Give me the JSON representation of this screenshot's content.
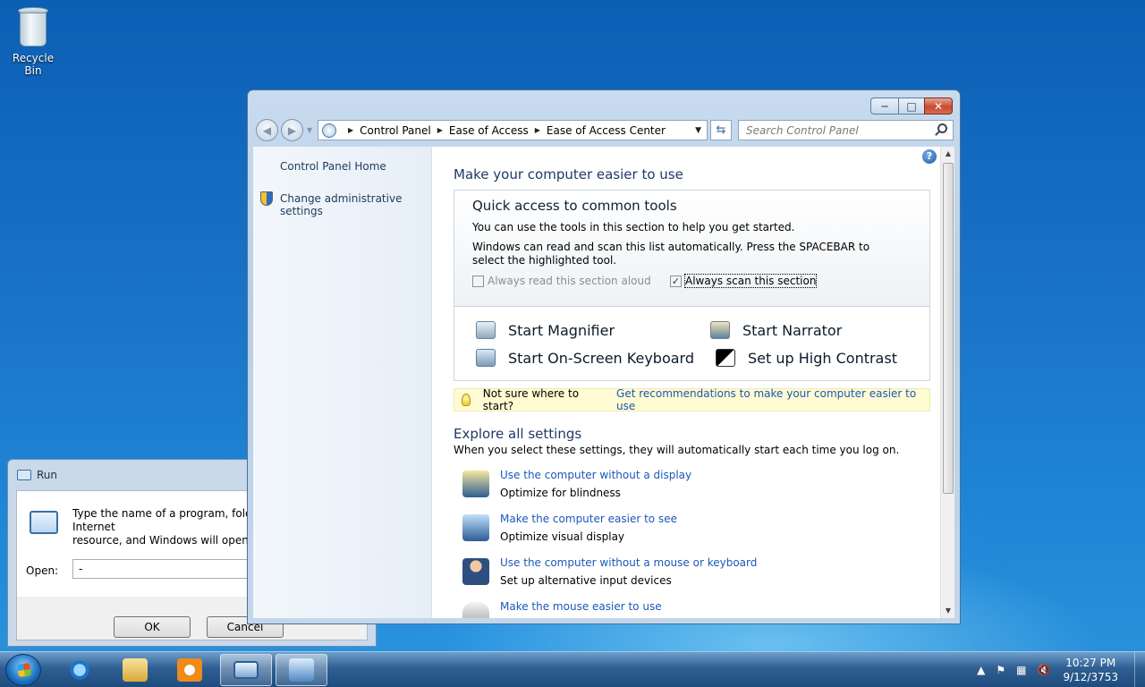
{
  "desktop": {
    "recycle_bin_label": "Recycle Bin"
  },
  "run_dialog": {
    "title": "Run",
    "description": "Type the name of a program, folder, document, or Internet\nresource, and Windows will open it for you.",
    "open_label": "Open:",
    "open_value": "-",
    "ok_label": "OK",
    "cancel_label": "Cancel"
  },
  "control_panel": {
    "window_buttons": {
      "minimize": "─",
      "maximize": "□",
      "close": "✕"
    },
    "breadcrumb": [
      "Control Panel",
      "Ease of Access",
      "Ease of Access Center"
    ],
    "search_placeholder": "Search Control Panel",
    "left_pane": {
      "home": "Control Panel Home",
      "admin": "Change administrative settings"
    },
    "main": {
      "heading": "Make your computer easier to use",
      "quick_access": {
        "title": "Quick access to common tools",
        "intro": "You can use the tools in this section to help you get started.",
        "scan_info": "Windows can read and scan this list automatically.  Press the SPACEBAR to select the highlighted tool.",
        "read_aloud": {
          "label": "Always read this section aloud",
          "checked": false,
          "enabled": false
        },
        "scan_section": {
          "label": "Always scan this section",
          "checked": true,
          "enabled": true
        },
        "tools": [
          {
            "label": "Start Magnifier",
            "icon": "magnifier-icon"
          },
          {
            "label": "Start Narrator",
            "icon": "narrator-icon"
          },
          {
            "label": "Start On-Screen Keyboard",
            "icon": "keyboard-icon"
          },
          {
            "label": "Set up High Contrast",
            "icon": "high-contrast-icon"
          }
        ]
      },
      "tip": {
        "prefix": "Not sure where to start?",
        "link": "Get recommendations to make your computer easier to use"
      },
      "explore": {
        "heading": "Explore all settings",
        "subtitle": "When you select these settings, they will automatically start each time you log on.",
        "items": [
          {
            "title": "Use the computer without a display",
            "desc": "Optimize for blindness",
            "icon": "display-icon"
          },
          {
            "title": "Make the computer easier to see",
            "desc": "Optimize visual display",
            "icon": "monitor-magnifier-icon"
          },
          {
            "title": "Use the computer without a mouse or keyboard",
            "desc": "Set up alternative input devices",
            "icon": "person-icon"
          },
          {
            "title": "Make the mouse easier to use",
            "desc": "",
            "icon": "mouse-icon"
          }
        ]
      }
    }
  },
  "taskbar": {
    "clock_time": "10:27 PM",
    "clock_date": "9/12/3753"
  },
  "colors": {
    "link": "#1c58b8",
    "heading": "#1e3a66",
    "tip_background": "#fffbd2",
    "desktop_blue": "#1a74c8"
  }
}
